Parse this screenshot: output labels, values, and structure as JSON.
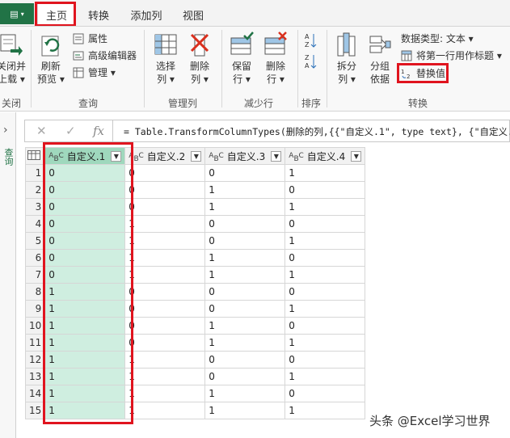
{
  "tabs": {
    "home": "主页",
    "transform": "转换",
    "add_column": "添加列",
    "view": "视图"
  },
  "ribbon": {
    "close": {
      "line1": "关闭并",
      "line2": "上载",
      "group": "关闭"
    },
    "query": {
      "refresh_line1": "刷新",
      "refresh_line2": "预览",
      "properties": "属性",
      "advanced_editor": "高级编辑器",
      "manage": "管理",
      "group": "查询"
    },
    "manage_columns": {
      "choose_line1": "选择",
      "choose_line2": "列",
      "remove_line1": "删除",
      "remove_line2": "列",
      "group": "管理列"
    },
    "reduce_rows": {
      "keep_line1": "保留",
      "keep_line2": "行",
      "remove_line1": "删除",
      "remove_line2": "行",
      "group": "减少行"
    },
    "sort": {
      "group": "排序"
    },
    "transform": {
      "split_line1": "拆分",
      "split_line2": "列",
      "groupby_line1": "分组",
      "groupby_line2": "依据",
      "data_type": "数据类型: 文本",
      "use_first_row": "将第一行用作标题",
      "replace_values": "替换值",
      "group": "转换"
    }
  },
  "left_pane": {
    "label": "查询"
  },
  "formula": "= Table.TransformColumnTypes(删除的列,{{\"自定义.1\", type text}, {\"自定义.2\"",
  "table": {
    "columns": [
      "自定义.1",
      "自定义.2",
      "自定义.3",
      "自定义.4"
    ],
    "rows": [
      [
        "0",
        "0",
        "0",
        "1"
      ],
      [
        "0",
        "0",
        "1",
        "0"
      ],
      [
        "0",
        "0",
        "1",
        "1"
      ],
      [
        "0",
        "1",
        "0",
        "0"
      ],
      [
        "0",
        "1",
        "0",
        "1"
      ],
      [
        "0",
        "1",
        "1",
        "0"
      ],
      [
        "0",
        "1",
        "1",
        "1"
      ],
      [
        "1",
        "0",
        "0",
        "0"
      ],
      [
        "1",
        "0",
        "0",
        "1"
      ],
      [
        "1",
        "0",
        "1",
        "0"
      ],
      [
        "1",
        "0",
        "1",
        "1"
      ],
      [
        "1",
        "1",
        "0",
        "0"
      ],
      [
        "1",
        "1",
        "0",
        "1"
      ],
      [
        "1",
        "1",
        "1",
        "0"
      ],
      [
        "1",
        "1",
        "1",
        "1"
      ]
    ]
  },
  "watermark": "头条 @Excel学习世界",
  "colors": {
    "accent": "#217346",
    "highlight": "#e0141e",
    "selected": "#cfeee0"
  }
}
